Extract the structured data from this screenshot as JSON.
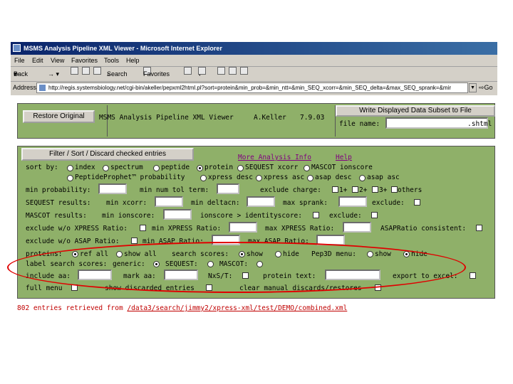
{
  "window": {
    "title": "MSMS Analysis Pipeline XML Viewer - Microsoft Internet Explorer"
  },
  "menu": [
    "File",
    "Edit",
    "View",
    "Favorites",
    "Tools",
    "Help"
  ],
  "toolbar": {
    "back": "Back",
    "search": "Search",
    "favorites": "Favorites"
  },
  "address": {
    "label": "Address",
    "url": "http://regis.systemsbiology.net/cgi-bin/akeller/pepxml2html.pl?sort=protein&min_prob=&min_ntt=&min_SEQ_xcorr=&min_SEQ_delta=&max_SEQ_sprank=&mir",
    "go": "Go"
  },
  "header": {
    "restore_button": "Restore Original",
    "app_title": "MSMS Analysis Pipeline XML Viewer",
    "author": "A.Keller",
    "version": "7.9.03",
    "write_button": "Write Displayed Data Subset to File",
    "file_name_label": "file name:",
    "file_ext": ".shtml"
  },
  "filter": {
    "filter_button": "Filter / Sort / Discard checked entries",
    "more_link": "More Analysis Info",
    "help_link": "Help",
    "sort_by": "sort by:",
    "sort_options": {
      "index": "index",
      "spectrum": "spectrum",
      "peptide": "peptide",
      "protein": "protein",
      "sequest_xcorr": "SEQUEST xcorr",
      "mascot_ionscore": "MASCOT ionscore",
      "peptideprophet": "PeptideProphet™ probability",
      "xpress_desc": "xpress desc",
      "xpress_asc": "xpress asc",
      "asap_desc": "asap desc",
      "asap_asc": "asap asc"
    },
    "min_probability": "min probability:",
    "min_num_tol_term": "min num tol term:",
    "exclude_charge": "exclude charge:",
    "charge_1": "1+",
    "charge_2": "2+",
    "charge_3": "3+",
    "charge_others": "others",
    "sequest_results": "SEQUEST results:",
    "min_xcorr": "min xcorr:",
    "min_deltacn": "min deltacn:",
    "max_sprank": "max sprank:",
    "exclude": "exclude:",
    "mascot_results": "MASCOT results:",
    "min_ionscore": "min ionscore:",
    "ionscore_gt": "ionscore > identityscore:",
    "exclude_wo_xpress": "exclude w/o XPRESS Ratio:",
    "min_xpress_ratio": "min XPRESS Ratio:",
    "max_xpress_ratio": "max XPRESS Ratio:",
    "asap_consistent": "ASAPRatio consistent:",
    "exclude_wo_asap": "exclude w/o ASAP Ratio:",
    "min_asap_ratio": "min ASAP Ratio:",
    "max_asap_ratio": "max ASAP Ratio:",
    "proteins": "proteins:",
    "ref_all": "ref all",
    "show_all": "show all",
    "search_scores": "search scores:",
    "show": "show",
    "hide": "hide",
    "pep3d_menu": "Pep3D menu:",
    "label_search_scores": "label search scores:",
    "generic": "generic:",
    "sequest_lbl": "SEQUEST:",
    "mascot_lbl": "MASCOT:",
    "include_aa": "include aa:",
    "mark_aa": "mark aa:",
    "nxst": "NxS/T:",
    "protein_text": "protein text:",
    "export_excel": "export to excel:",
    "full_menu": "full menu",
    "show_discarded": "show discarded entries",
    "clear_manual": "clear manual discards/restores"
  },
  "status": {
    "prefix": "802 entries retrieved from",
    "path": "/data3/search/jimmy2/xpress-xml/test/DEMO/combined.xml"
  },
  "annotation": {
    "color": "#e00000"
  }
}
